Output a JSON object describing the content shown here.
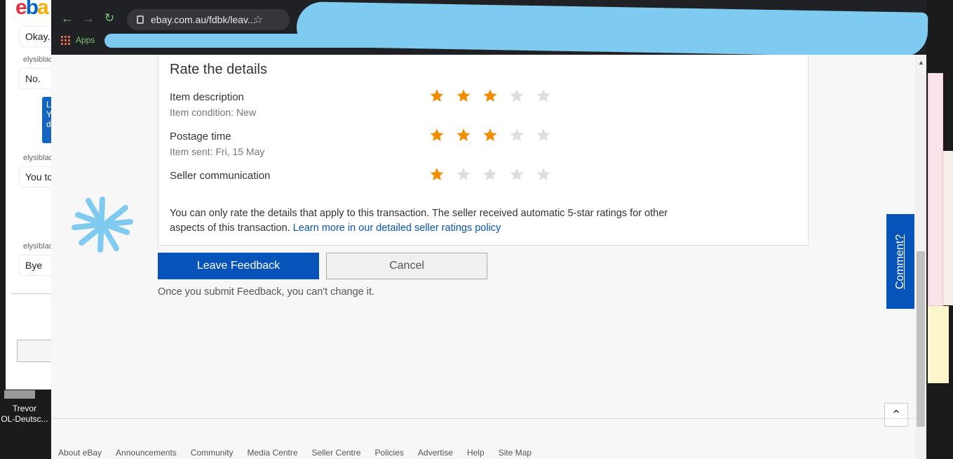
{
  "background": {
    "chat": {
      "brand": {
        "e": "e",
        "b": "b",
        "a": "a"
      },
      "messages": [
        {
          "sender": "",
          "text": "Okay."
        },
        {
          "sender": "elysiblack",
          "text": "No."
        },
        {
          "sender": "",
          "text": "Le"
        },
        {
          "sender": "elysiblack",
          "text": "You to"
        },
        {
          "sender": "elysiblack",
          "text": "Bye"
        }
      ],
      "blue_bubble_lines": [
        "Le",
        "Yo",
        "da"
      ]
    },
    "desktop_icon_label": "Trevor\nOL-Deutsc..."
  },
  "browser": {
    "url": "ebay.com.au/fdbk/leav...",
    "bookmarks_label": "Apps"
  },
  "feedback": {
    "title": "Rate the details",
    "rows": [
      {
        "label": "Item description",
        "sub": "Item condition: New",
        "rating": 3,
        "max": 5
      },
      {
        "label": "Postage time",
        "sub": "Item sent: Fri, 15 May",
        "rating": 3,
        "max": 5
      },
      {
        "label": "Seller communication",
        "sub": "",
        "rating": 1,
        "max": 5
      }
    ],
    "note": "You can only rate the details that apply to this transaction. The seller received automatic 5-star ratings for other aspects of this transaction.",
    "note_link": "Learn more in our detailed seller ratings policy",
    "leave_button": "Leave Feedback",
    "cancel_button": "Cancel",
    "submit_note": "Once you submit Feedback, you can't change it."
  },
  "comment_tab": "Comment?",
  "footer_links": [
    "About eBay",
    "Announcements",
    "Community",
    "Media Centre",
    "Seller Centre",
    "Policies",
    "Advertise",
    "Help",
    "Site Map"
  ],
  "colors": {
    "star_on": "#f18c00",
    "star_off": "#dddddd",
    "accent": "#0654ba"
  }
}
